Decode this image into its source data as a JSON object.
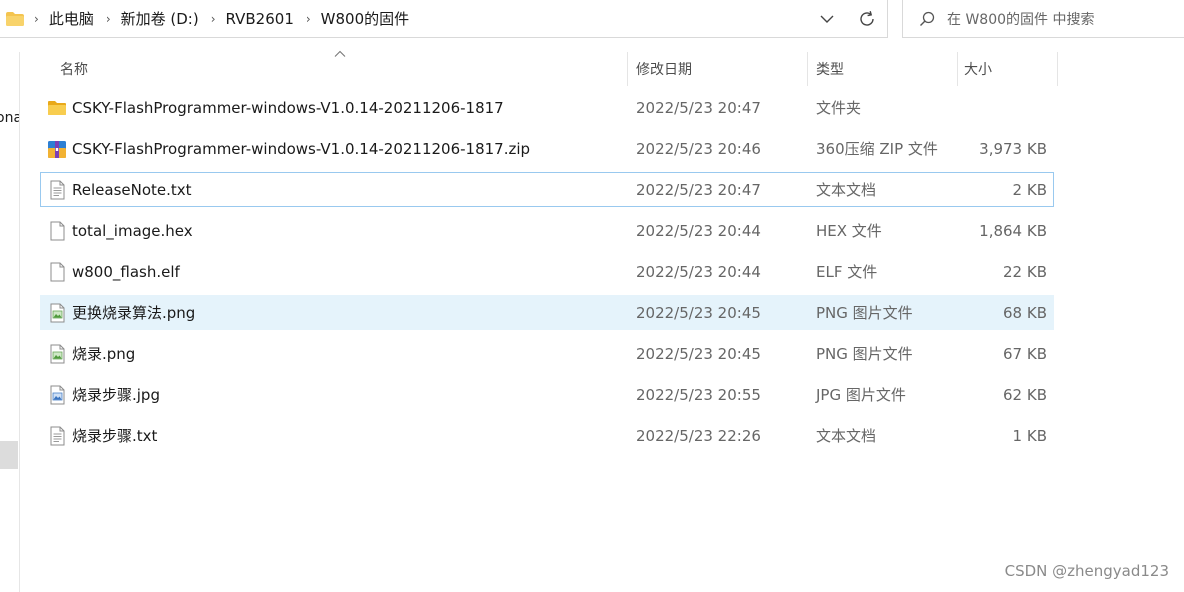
{
  "breadcrumb": {
    "items": [
      "此电脑",
      "新加卷 (D:)",
      "RVB2601",
      "W800的固件"
    ]
  },
  "search": {
    "placeholder": "在 W800的固件 中搜索"
  },
  "nav": {
    "cut_label": "ona"
  },
  "columns": {
    "name": "名称",
    "date": "修改日期",
    "type": "类型",
    "size": "大小"
  },
  "files": [
    {
      "name": "CSKY-FlashProgrammer-windows-V1.0.14-20211206-1817",
      "date": "2022/5/23 20:47",
      "type": "文件夹",
      "size": "",
      "icon": "folder-icon"
    },
    {
      "name": "CSKY-FlashProgrammer-windows-V1.0.14-20211206-1817.zip",
      "date": "2022/5/23 20:46",
      "type": "360压缩 ZIP 文件",
      "size": "3,973 KB",
      "icon": "zip-archive-icon"
    },
    {
      "name": "ReleaseNote.txt",
      "date": "2022/5/23 20:47",
      "type": "文本文档",
      "size": "2 KB",
      "icon": "text-file-icon"
    },
    {
      "name": "total_image.hex",
      "date": "2022/5/23 20:44",
      "type": "HEX 文件",
      "size": "1,864 KB",
      "icon": "blank-file-icon"
    },
    {
      "name": "w800_flash.elf",
      "date": "2022/5/23 20:44",
      "type": "ELF 文件",
      "size": "22 KB",
      "icon": "blank-file-icon"
    },
    {
      "name": "更换烧录算法.png",
      "date": "2022/5/23 20:45",
      "type": "PNG 图片文件",
      "size": "68 KB",
      "icon": "png-image-icon"
    },
    {
      "name": "烧录.png",
      "date": "2022/5/23 20:45",
      "type": "PNG 图片文件",
      "size": "67 KB",
      "icon": "png-image-icon"
    },
    {
      "name": "烧录步骤.jpg",
      "date": "2022/5/23 20:55",
      "type": "JPG 图片文件",
      "size": "62 KB",
      "icon": "jpg-image-icon"
    },
    {
      "name": "烧录步骤.txt",
      "date": "2022/5/23 22:26",
      "type": "文本文档",
      "size": "1 KB",
      "icon": "text-file-icon"
    }
  ],
  "watermark": "CSDN @zhengyad123",
  "colors": {
    "folder": "#f4c44f",
    "hover_row": "#e5f3fb",
    "focus_border": "#99c9ef"
  }
}
